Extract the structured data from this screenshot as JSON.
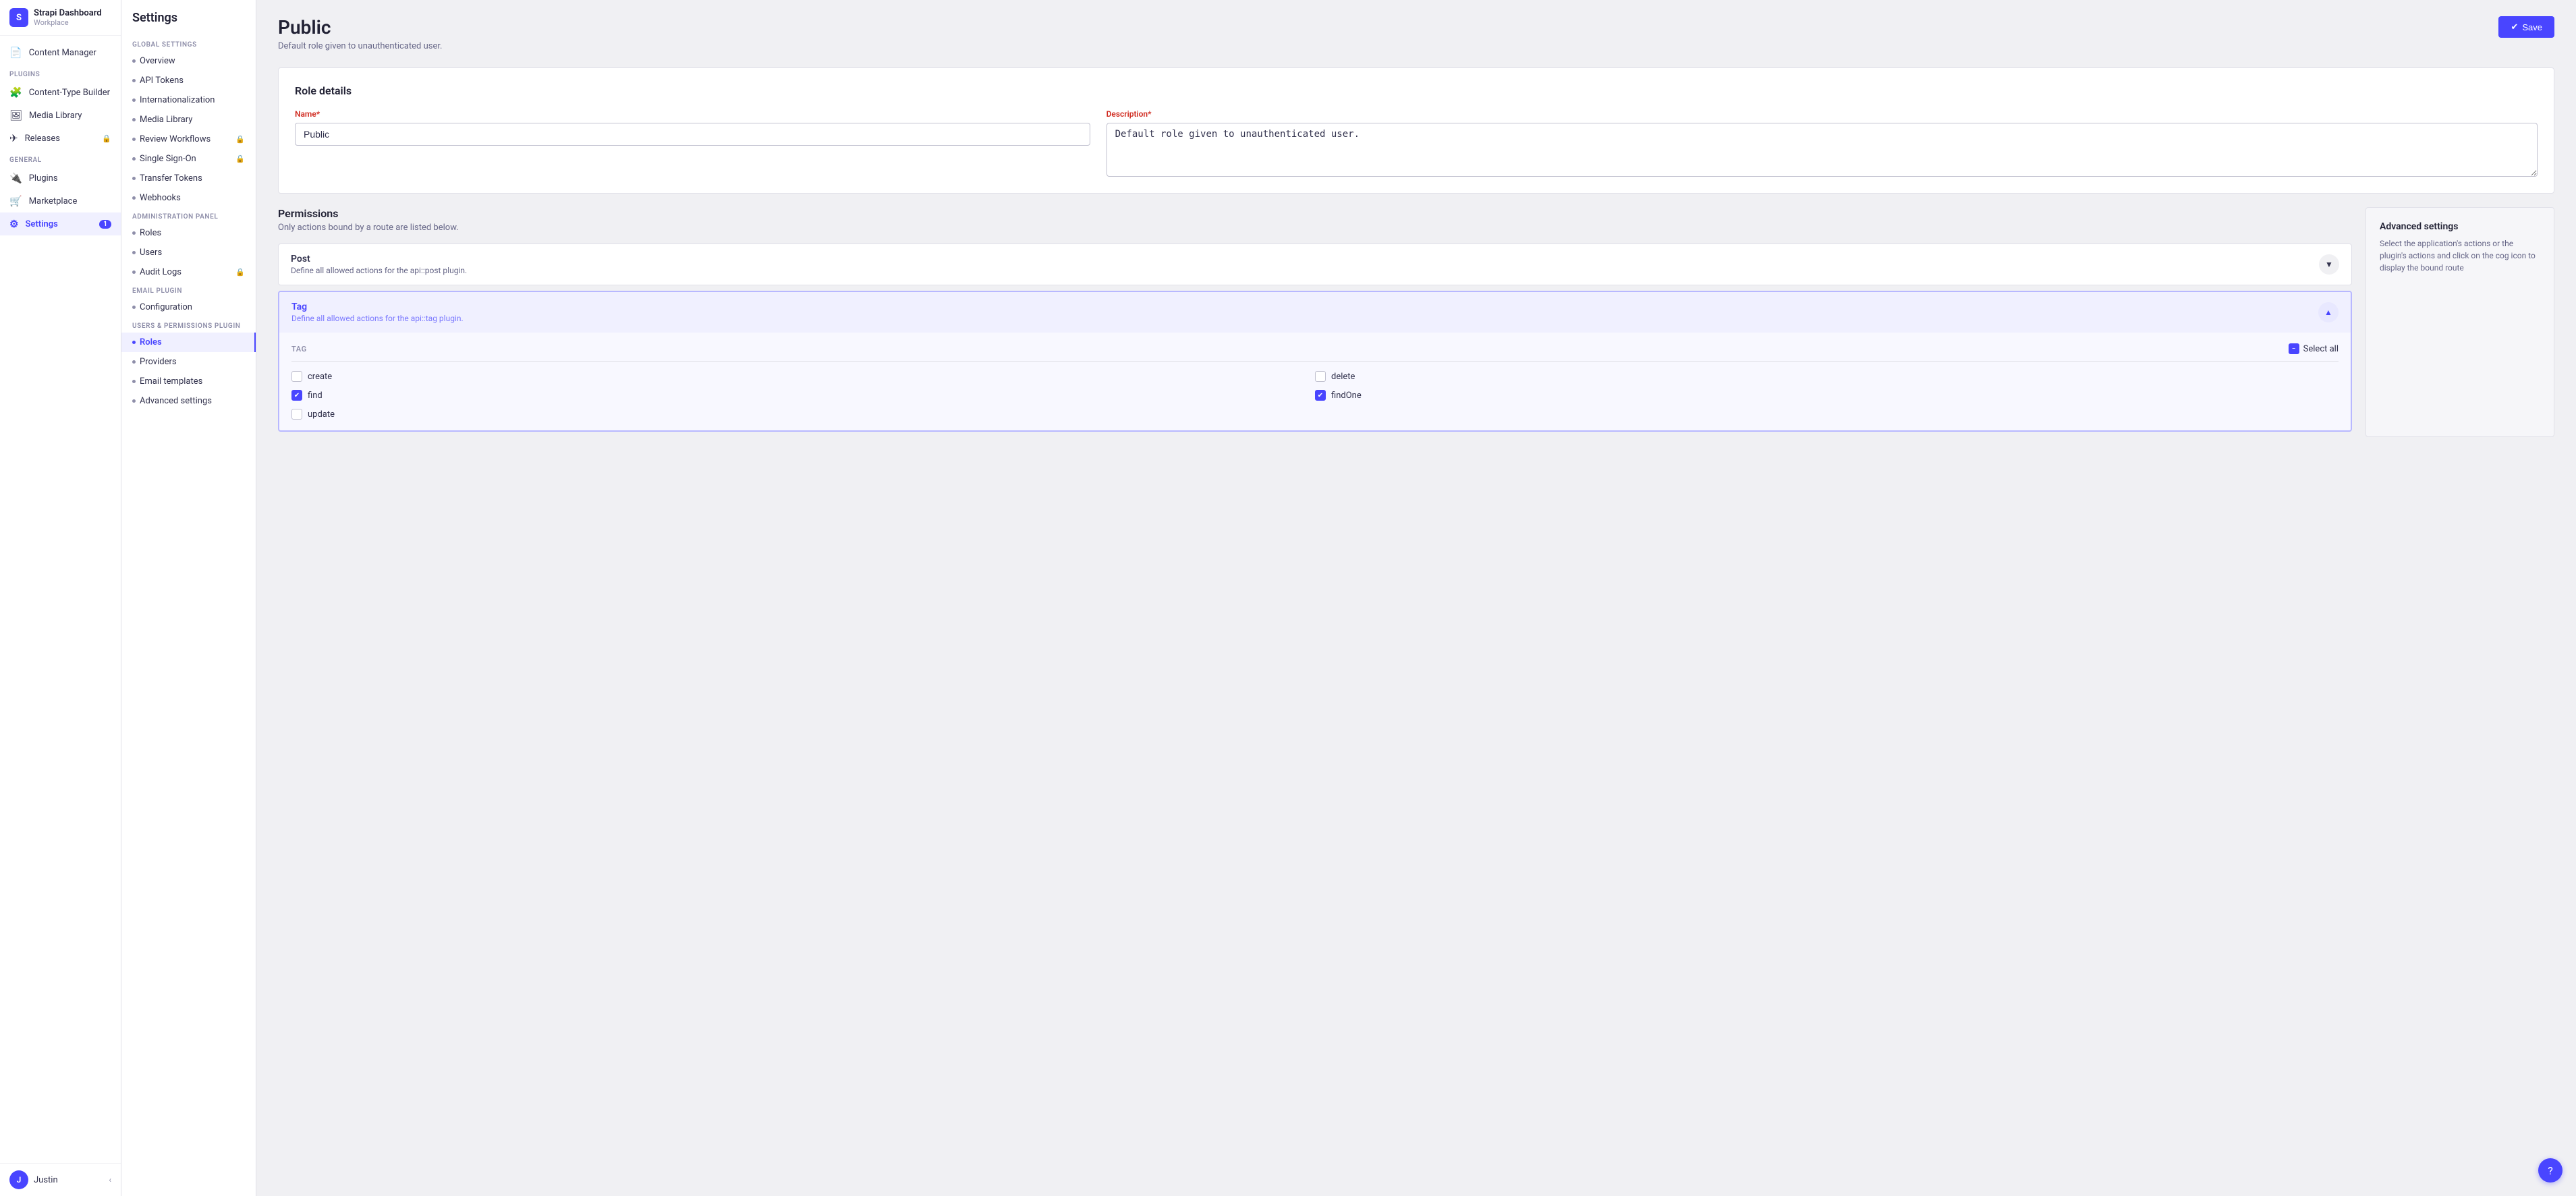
{
  "sidebar": {
    "brand": {
      "name": "Strapi Dashboard",
      "subtitle": "Workplace",
      "logo_letter": "S"
    },
    "sections": [
      {
        "label": null,
        "items": [
          {
            "id": "content-manager",
            "label": "Content Manager",
            "icon": "📄",
            "active": false
          }
        ]
      },
      {
        "label": "PLUGINS",
        "items": [
          {
            "id": "content-type-builder",
            "label": "Content-Type Builder",
            "icon": "🧩",
            "active": false
          },
          {
            "id": "media-library",
            "label": "Media Library",
            "icon": "🖼",
            "active": false
          },
          {
            "id": "releases",
            "label": "Releases",
            "icon": "✈",
            "active": false,
            "lock": true
          }
        ]
      },
      {
        "label": "GENERAL",
        "items": [
          {
            "id": "plugins",
            "label": "Plugins",
            "icon": "🔌",
            "active": false
          },
          {
            "id": "marketplace",
            "label": "Marketplace",
            "icon": "🛒",
            "active": false
          },
          {
            "id": "settings",
            "label": "Settings",
            "icon": "⚙",
            "active": true,
            "badge": "1"
          }
        ]
      }
    ],
    "footer": {
      "user": "Justin",
      "avatar_letter": "J"
    }
  },
  "settings_panel": {
    "title": "Settings",
    "groups": [
      {
        "label": "GLOBAL SETTINGS",
        "items": [
          {
            "id": "overview",
            "label": "Overview",
            "active": false
          },
          {
            "id": "api-tokens",
            "label": "API Tokens",
            "active": false
          },
          {
            "id": "internationalization",
            "label": "Internationalization",
            "active": false
          },
          {
            "id": "media-library",
            "label": "Media Library",
            "active": false
          },
          {
            "id": "review-workflows",
            "label": "Review Workflows",
            "active": false,
            "lock": true
          },
          {
            "id": "single-sign-on",
            "label": "Single Sign-On",
            "active": false,
            "lock": true
          },
          {
            "id": "transfer-tokens",
            "label": "Transfer Tokens",
            "active": false
          },
          {
            "id": "webhooks",
            "label": "Webhooks",
            "active": false
          }
        ]
      },
      {
        "label": "ADMINISTRATION PANEL",
        "items": [
          {
            "id": "roles",
            "label": "Roles",
            "active": false
          },
          {
            "id": "users",
            "label": "Users",
            "active": false
          },
          {
            "id": "audit-logs",
            "label": "Audit Logs",
            "active": false,
            "lock": true
          }
        ]
      },
      {
        "label": "EMAIL PLUGIN",
        "items": [
          {
            "id": "configuration",
            "label": "Configuration",
            "active": false
          }
        ]
      },
      {
        "label": "USERS & PERMISSIONS PLUGIN",
        "items": [
          {
            "id": "up-roles",
            "label": "Roles",
            "active": true
          },
          {
            "id": "providers",
            "label": "Providers",
            "active": false
          },
          {
            "id": "email-templates",
            "label": "Email templates",
            "active": false
          },
          {
            "id": "advanced-settings",
            "label": "Advanced settings",
            "active": false
          }
        ]
      }
    ]
  },
  "page": {
    "title": "Public",
    "subtitle": "Default role given to unauthenticated user.",
    "save_button": "Save"
  },
  "role_details": {
    "section_title": "Role details",
    "name_label": "Name",
    "name_required": "*",
    "name_value": "Public",
    "description_label": "Description",
    "description_required": "*",
    "description_value": "Default role given to unauthenticated user."
  },
  "permissions": {
    "title": "Permissions",
    "subtitle": "Only actions bound by a route are listed below.",
    "sections": [
      {
        "id": "post",
        "title": "Post",
        "description": "Define all allowed actions for the api::post plugin.",
        "expanded": false
      },
      {
        "id": "tag",
        "title": "Tag",
        "description": "Define all allowed actions for the api::tag plugin.",
        "expanded": true,
        "tag_label": "TAG",
        "select_all_label": "Select all",
        "checkboxes": [
          {
            "id": "create",
            "label": "create",
            "checked": false
          },
          {
            "id": "delete",
            "label": "delete",
            "checked": false
          },
          {
            "id": "find",
            "label": "find",
            "checked": true
          },
          {
            "id": "findOne",
            "label": "findOne",
            "checked": true
          },
          {
            "id": "update",
            "label": "update",
            "checked": false
          }
        ]
      }
    ]
  },
  "advanced_settings": {
    "title": "Advanced settings",
    "description": "Select the application's actions or the plugin's actions and click on the cog icon to display the bound route"
  },
  "help": {
    "icon": "?"
  }
}
